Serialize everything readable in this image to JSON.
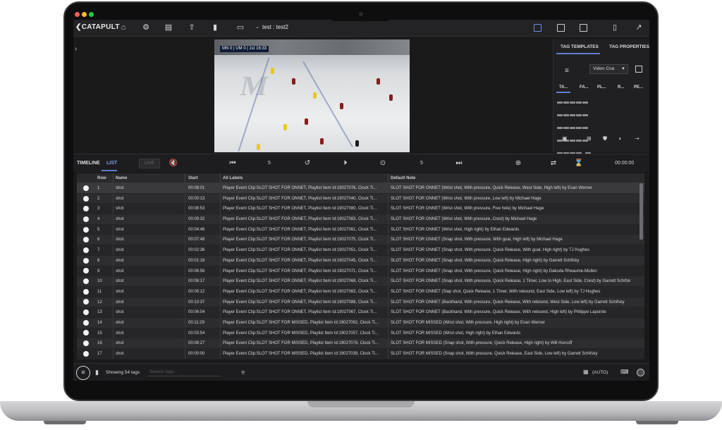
{
  "window": {
    "colors": {
      "close": "#ff5f57",
      "minimize": "#febc2e",
      "maximize": "#28c840"
    }
  },
  "toolbar": {
    "brand": "CATAPULT",
    "session": "test : test2",
    "icons": [
      "home-icon",
      "gear-icon",
      "clips-icon",
      "export-icon",
      "bookmark-icon",
      "monitor-icon",
      "chevron-down-icon"
    ]
  },
  "video": {
    "scorebug": "MN 0 | UM 0 | 1st 16:33"
  },
  "right_panel": {
    "tab_templates": "TAG TEMPLATES",
    "tab_properties": "TAG PROPERTIES",
    "dropdown_value": "Video Coa",
    "template_tabs": [
      "TA...",
      "FA...",
      "PL...",
      "R...",
      "PE..."
    ]
  },
  "playback": {
    "tab_timeline": "TIMELINE",
    "tab_list": "LIST",
    "live": "LIVE",
    "skip_back": "5",
    "skip_forward": "5",
    "timer": "00:00:00",
    "accent": "#5f7fcf"
  },
  "table": {
    "columns": {
      "row": "Row",
      "name": "Name",
      "start": "Start",
      "labels": "All Labels",
      "note": "Default Note"
    },
    "rows": [
      {
        "row": "1",
        "name": "shot",
        "start": "00:08:01",
        "labels": "Player Event Clip:SLOT SHOT FOR ONNET, Playlist Item Id:19027076, Clock Ti...",
        "note": "SLOT SHOT FOR ONNET (Wrist shot, With pressure, Quick Release, West Side, High left) by Evan Werner"
      },
      {
        "row": "2",
        "name": "shot",
        "start": "00:00:13",
        "labels": "Player Event Clip:SLOT SHOT FOR ONNET, Playlist Item Id:19027040, Clock Ti...",
        "note": "SLOT SHOT FOR ONNET (Wrist shot, With pressure, Low left) by Michael Hage"
      },
      {
        "row": "3",
        "name": "shot",
        "start": "00:08:53",
        "labels": "Player Event Clip:SLOT SHOT FOR ONNET, Playlist Item Id:19027080, Clock Ti...",
        "note": "SLOT SHOT FOR ONNET (Wrist shot, With pressure, Five hole) by Michael Hage"
      },
      {
        "row": "4",
        "name": "shot",
        "start": "00:09:32",
        "labels": "Player Event Clip:SLOT SHOT FOR ONNET, Playlist Item Id:19027083, Clock Ti...",
        "note": "SLOT SHOT FOR ONNET (Wrist shot, With pressure, Crest) by Michael Hage"
      },
      {
        "row": "5",
        "name": "shot",
        "start": "00:04:46",
        "labels": "Player Event Clip:SLOT SHOT FOR ONNET, Playlist Item Id:19027061, Clock Ti...",
        "note": "SLOT SHOT FOR ONNET (Wrist shot, High right) by Ethan Edwards"
      },
      {
        "row": "6",
        "name": "shot",
        "start": "00:07:48",
        "labels": "Player Event Clip:SLOT SHOT FOR ONNET, Playlist Item Id:19027075, Clock Ti...",
        "note": "SLOT SHOT FOR ONNET (Snap shot, With pressure, With goal, High left) by Michael Hage"
      },
      {
        "row": "7",
        "name": "shot",
        "start": "00:02:36",
        "labels": "Player Event Clip:SLOT SHOT FOR ONNET, Playlist Item Id:19027051, Clock Ti...",
        "note": "SLOT SHOT FOR ONNET (Snap shot, With pressure, Quick Release, With goal, High right) by TJ Hughes"
      },
      {
        "row": "8",
        "name": "shot",
        "start": "00:01:18",
        "labels": "Player Event Clip:SLOT SHOT FOR ONNET, Playlist Item Id:19027045, Clock Ti...",
        "note": "SLOT SHOT FOR ONNET (Snap shot, With pressure, Quick Release, High right) by Garrett Schifsky"
      },
      {
        "row": "9",
        "name": "shot",
        "start": "00:06:56",
        "labels": "Player Event Clip:SLOT SHOT FOR ONNET, Playlist Item Id:19027071, Clock Ti...",
        "note": "SLOT SHOT FOR ONNET (Snap shot, With pressure, Quick Release, High right) by Dakoda Rheaume-Mullen"
      },
      {
        "row": "10",
        "name": "shot",
        "start": "00:06:17",
        "labels": "Player Event Clip:SLOT SHOT FOR ONNET, Playlist Item Id:19027068, Clock Ti...",
        "note": "SLOT SHOT FOR ONNET (Snap shot, With pressure, Quick Release, 1 Timer, Low to High, East Side, Crest) by Garrett Schifsk"
      },
      {
        "row": "11",
        "name": "shot",
        "start": "00:05:12",
        "labels": "Player Event Clip:SLOT SHOT FOR ONNET, Playlist Item Id:19027063, Clock Ti...",
        "note": "SLOT SHOT FOR ONNET (Slap shot, Quick Release, 1 Timer, With rebound, East Side, Low left) by TJ Hughes"
      },
      {
        "row": "12",
        "name": "shot",
        "start": "00:10:37",
        "labels": "Player Event Clip:SLOT SHOT FOR ONNET, Playlist Item Id:19027088, Clock Ti...",
        "note": "SLOT SHOT FOR ONNET (Backhand, With pressure, Quick Release, With rebound, West Side, Low left) by Garrett Schifsky"
      },
      {
        "row": "13",
        "name": "shot",
        "start": "00:06:04",
        "labels": "Player Event Clip:SLOT SHOT FOR ONNET, Playlist Item Id:19027067, Clock Ti...",
        "note": "SLOT SHOT FOR ONNET (Backhand, With pressure, Quick Release, With rebound, High left) by Philippe Lapointe"
      },
      {
        "row": "14",
        "name": "shot",
        "start": "00:11:29",
        "labels": "Player Event Clip:SLOT SHOT FOR MISSED, Playlist Item Id:19027092, Clock Ti...",
        "note": "SLOT SHOT FOR MISSED (Wrist shot, With pressure, High right) by Evan Werner"
      },
      {
        "row": "15",
        "name": "shot",
        "start": "00:03:54",
        "labels": "Player Event Clip:SLOT SHOT FOR MISSED, Playlist Item Id:19027057, Clock Ti...",
        "note": "SLOT SHOT FOR MISSED (Wrist shot, High right) by Ethan Edwards"
      },
      {
        "row": "16",
        "name": "shot",
        "start": "00:08:27",
        "labels": "Player Event Clip:SLOT SHOT FOR MISSED, Playlist Item Id:19027078, Clock Ti...",
        "note": "SLOT SHOT FOR MISSED (Snap shot, With pressure, Quick Release, High right) by Will Horcoff"
      },
      {
        "row": "17",
        "name": "shot",
        "start": "00:00:00",
        "labels": "Player Event Clip:SLOT SHOT FOR MISSED, Playlist Item Id:19027039, Clock Ti...",
        "note": "SLOT SHOT FOR MISSED (Snap shot, With pressure, Quick Release, East Side, Low left) by Garrett Schifsky"
      }
    ]
  },
  "footer": {
    "showing": "Showing 54 tags",
    "search_placeholder": "Search tags...",
    "auto": "(AUTO)"
  }
}
